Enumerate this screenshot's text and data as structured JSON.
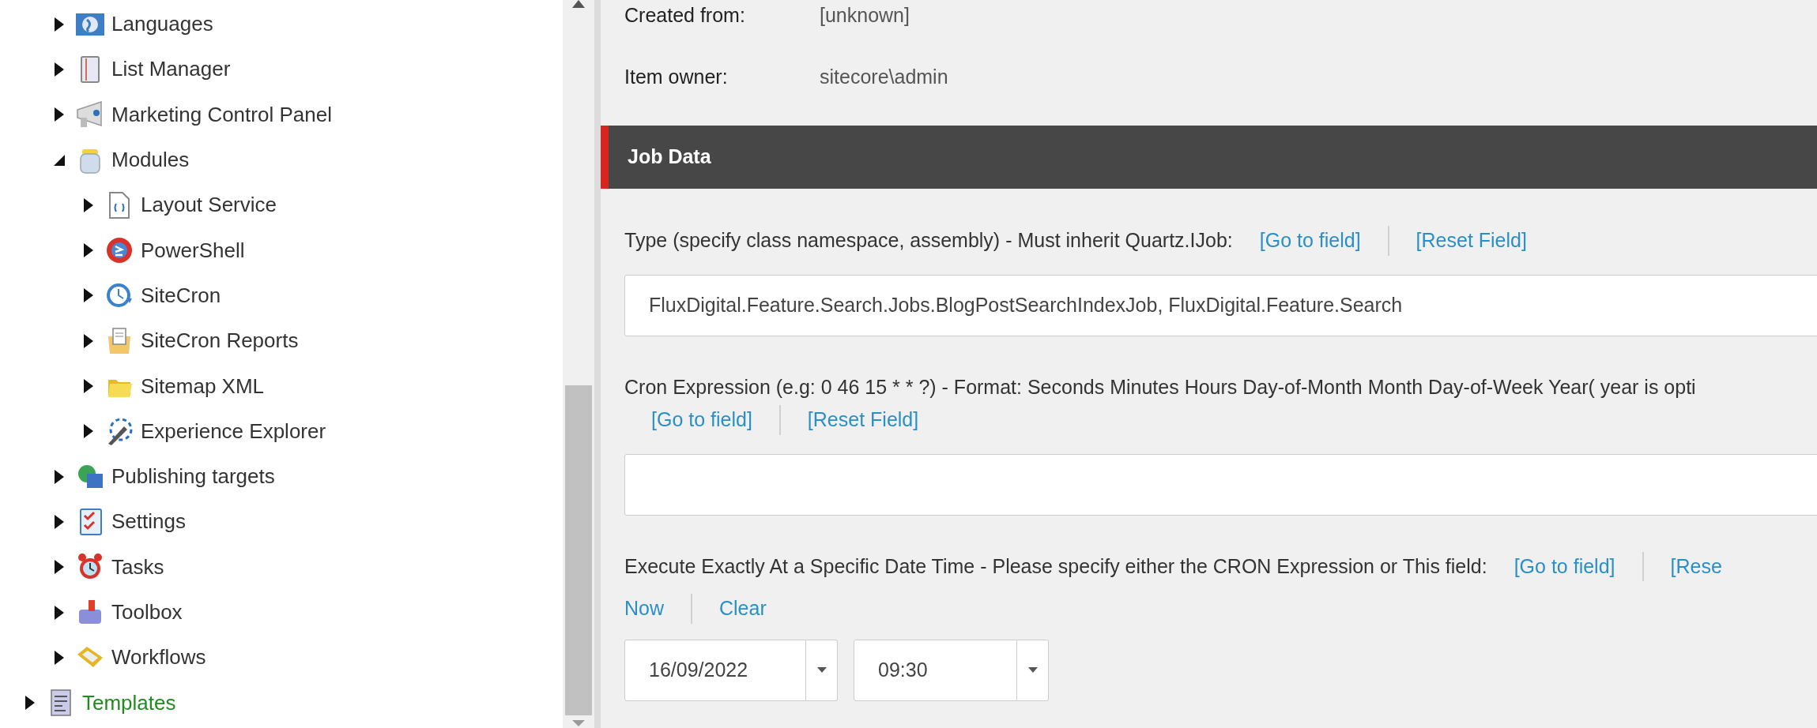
{
  "tree": [
    {
      "children": [
        {
          "label": "Languages",
          "expanded": false
        },
        {
          "label": "List Manager",
          "expanded": false
        },
        {
          "label": "Marketing Control Panel",
          "expanded": false
        },
        {
          "label": "Modules",
          "expanded": true,
          "children": [
            {
              "label": "Layout Service",
              "expanded": false
            },
            {
              "label": "PowerShell",
              "expanded": false
            },
            {
              "label": "SiteCron",
              "expanded": false
            },
            {
              "label": "SiteCron Reports",
              "expanded": false
            },
            {
              "label": "Sitemap XML",
              "expanded": false
            },
            {
              "label": "Experience Explorer",
              "expanded": false
            }
          ]
        },
        {
          "label": "Publishing targets",
          "expanded": false
        },
        {
          "label": "Settings",
          "expanded": false
        },
        {
          "label": "Tasks",
          "expanded": false
        },
        {
          "label": "Toolbox",
          "expanded": false
        },
        {
          "label": "Workflows",
          "expanded": false
        }
      ]
    },
    {
      "label": "Templates",
      "expanded": false,
      "color": "#1e8c1e"
    }
  ],
  "info": [
    {
      "label": "Created from:",
      "value": "[unknown]"
    },
    {
      "label": "Item owner:",
      "value": "sitecore\\admin"
    }
  ],
  "section": {
    "title": "Job Data"
  },
  "fields": [
    {
      "kind": "text",
      "label": "Type (specify class namespace, assembly) - Must inherit Quartz.IJob:",
      "links": [
        "[Go to field]",
        "[Reset Field]"
      ],
      "value": "FluxDigital.Feature.Search.Jobs.BlogPostSearchIndexJob, FluxDigital.Feature.Search"
    },
    {
      "kind": "text",
      "label": "Cron Expression (e.g: 0 46 15 * * ?) - Format: Seconds Minutes Hours Day-of-Month Month Day-of-Week Year( year is opti",
      "links": [
        "[Go to field]",
        "[Reset Field]"
      ]
    },
    {
      "kind": "datetime",
      "label": "Execute Exactly At a Specific Date Time - Please specify either the CRON Expression or This field:",
      "links": [
        "[Go to field]",
        "[Rese"
      ],
      "actions": [
        "Now",
        "Clear"
      ],
      "date": "16/09/2022",
      "time": "09:30"
    }
  ]
}
